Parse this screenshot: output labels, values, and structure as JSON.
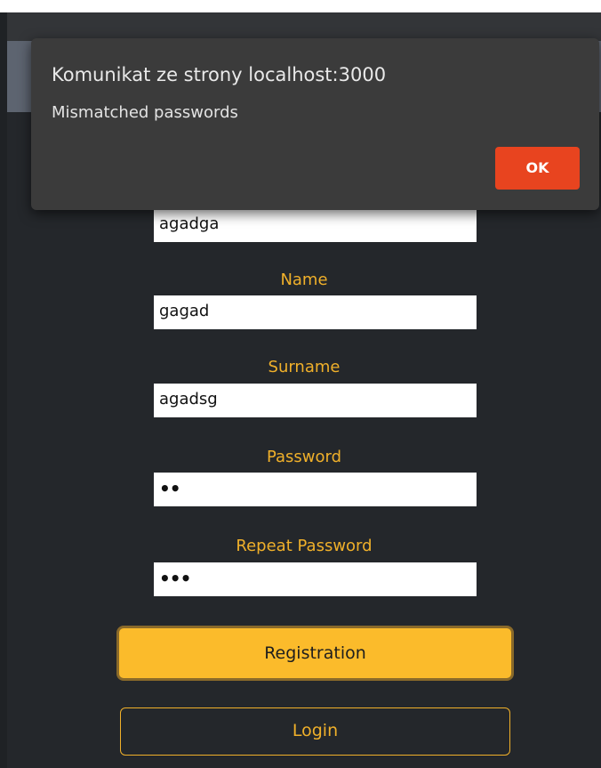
{
  "dialog": {
    "title": "Komunikat ze strony localhost:3000",
    "message": "Mismatched passwords",
    "ok_label": "OK"
  },
  "form": {
    "first_field_value": "agadga",
    "name_label": "Name",
    "name_value": "gagad",
    "surname_label": "Surname",
    "surname_value": "agadsg",
    "password_label": "Password",
    "password_value": "••",
    "repeat_password_label": "Repeat Password",
    "repeat_password_value": "•••",
    "registration_label": "Registration",
    "login_label": "Login"
  },
  "colors": {
    "accent": "#f0b02a",
    "button_fill": "#fbbb2b",
    "dialog_bg": "#3b3b3b",
    "ok_button": "#e8441f",
    "page_bg": "#24272b"
  }
}
